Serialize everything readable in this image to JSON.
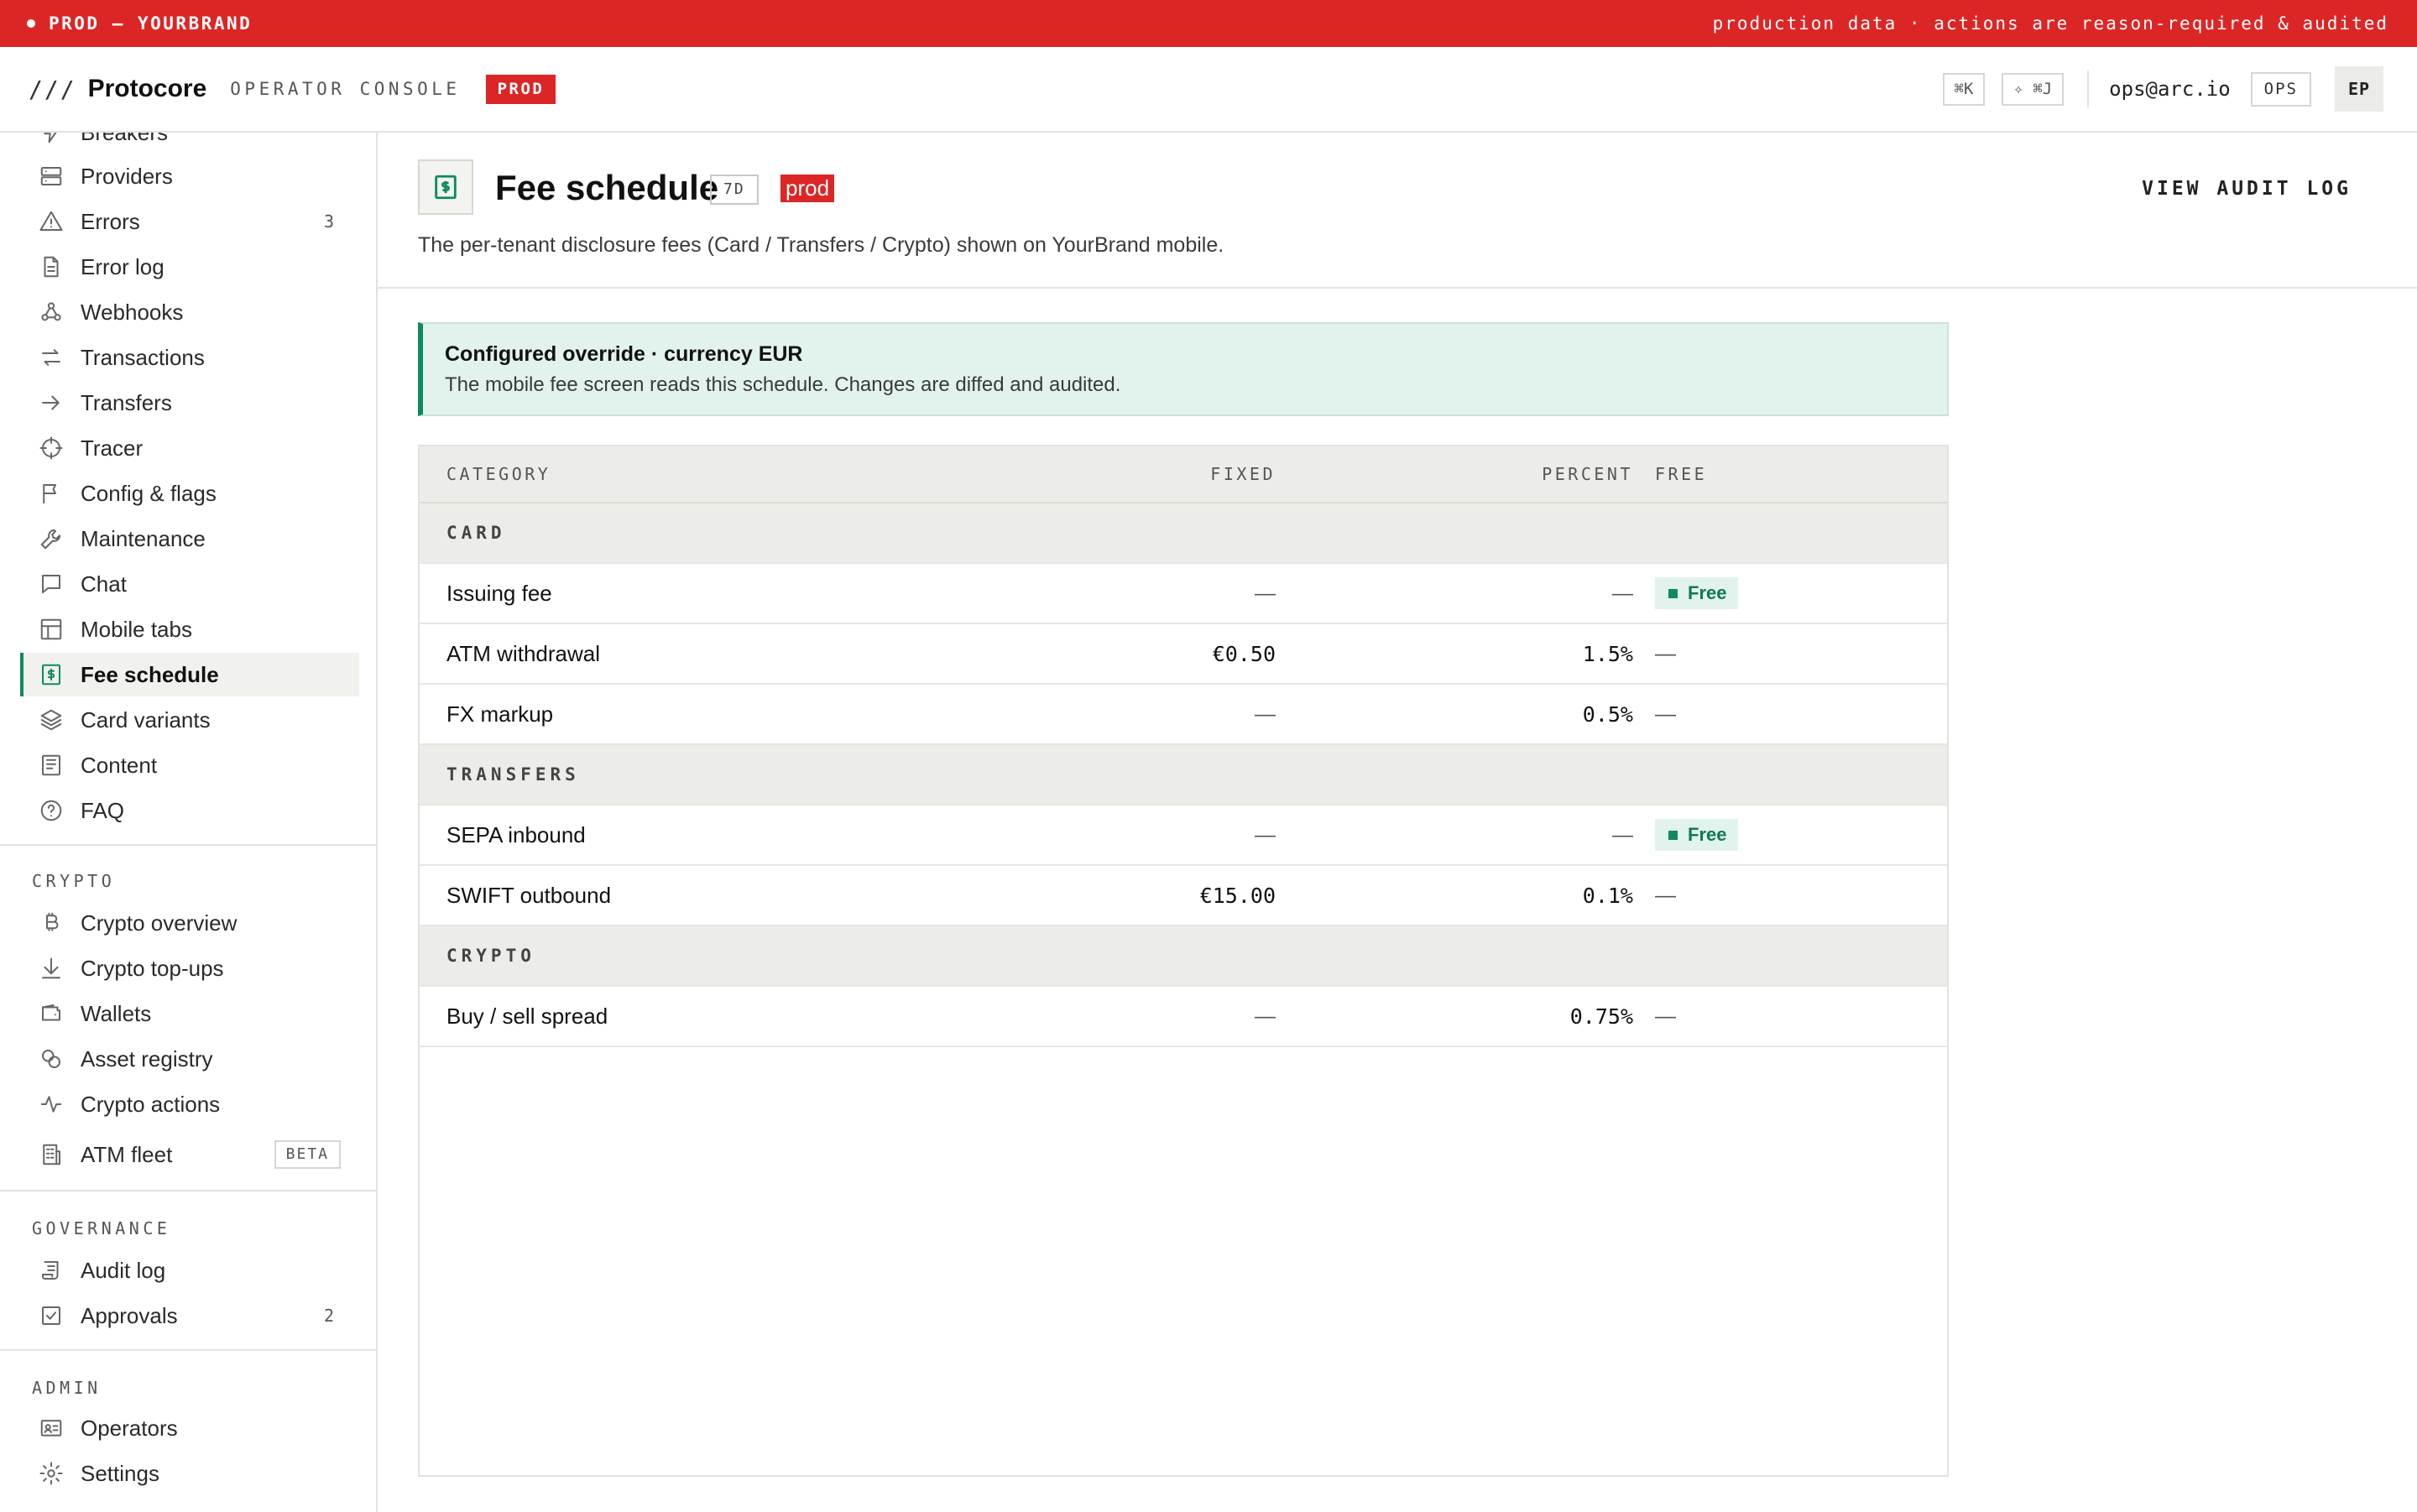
{
  "banner": {
    "env_label": "PROD — YOURBRAND",
    "notice": "production data · actions are reason-required & audited"
  },
  "header": {
    "brand_mark": "///",
    "brand_name": "Protocore",
    "console_label": "OPERATOR CONSOLE",
    "env_chip": "PROD",
    "shortcut_search": "⌘K",
    "shortcut_ai": "✧ ⌘J",
    "user_email": "ops@arc.io",
    "role": "OPS",
    "avatar_initials": "EP"
  },
  "sidebar": {
    "partial_item": "Breakers",
    "items": [
      {
        "label": "Providers",
        "icon": "server-icon"
      },
      {
        "label": "Errors",
        "icon": "warning-icon",
        "count": "3"
      },
      {
        "label": "Error log",
        "icon": "document-icon"
      },
      {
        "label": "Webhooks",
        "icon": "webhook-icon"
      },
      {
        "label": "Transactions",
        "icon": "swap-icon"
      },
      {
        "label": "Transfers",
        "icon": "arrow-right-icon"
      },
      {
        "label": "Tracer",
        "icon": "crosshair-icon"
      },
      {
        "label": "Config & flags",
        "icon": "flag-icon"
      },
      {
        "label": "Maintenance",
        "icon": "wrench-icon"
      },
      {
        "label": "Chat",
        "icon": "chat-icon"
      },
      {
        "label": "Mobile tabs",
        "icon": "layout-icon"
      },
      {
        "label": "Fee schedule",
        "icon": "dollar-receipt-icon",
        "active": true
      },
      {
        "label": "Card variants",
        "icon": "layers-icon"
      },
      {
        "label": "Content",
        "icon": "newspaper-icon"
      },
      {
        "label": "FAQ",
        "icon": "help-circle-icon"
      }
    ],
    "crypto_title": "CRYPTO",
    "crypto_items": [
      {
        "label": "Crypto overview",
        "icon": "bitcoin-icon"
      },
      {
        "label": "Crypto top-ups",
        "icon": "download-icon"
      },
      {
        "label": "Wallets",
        "icon": "wallet-icon"
      },
      {
        "label": "Asset registry",
        "icon": "coins-icon"
      },
      {
        "label": "Crypto actions",
        "icon": "activity-icon"
      },
      {
        "label": "ATM fleet",
        "icon": "building-icon",
        "badge": "BETA"
      }
    ],
    "governance_title": "GOVERNANCE",
    "governance_items": [
      {
        "label": "Audit log",
        "icon": "scroll-icon"
      },
      {
        "label": "Approvals",
        "icon": "check-square-icon",
        "count": "2"
      }
    ],
    "admin_title": "ADMIN",
    "admin_items": [
      {
        "label": "Operators",
        "icon": "id-card-icon"
      },
      {
        "label": "Settings",
        "icon": "gear-icon"
      }
    ]
  },
  "page": {
    "title": "Fee schedule",
    "range": "7D",
    "env_tag": "prod",
    "subtitle": "The per-tenant disclosure fees (Card / Transfers / Crypto) shown on YourBrand mobile.",
    "audit_link": "VIEW AUDIT LOG"
  },
  "notice": {
    "title": "Configured override · currency EUR",
    "body": "The mobile fee screen reads this schedule. Changes are diffed and audited."
  },
  "fees": {
    "columns": {
      "category": "CATEGORY",
      "fixed": "FIXED",
      "percent": "PERCENT",
      "free": "FREE"
    },
    "groups": [
      {
        "name": "CARD",
        "rows": [
          {
            "category": "Issuing fee",
            "fixed": "—",
            "percent": "—",
            "free": "Free"
          },
          {
            "category": "ATM withdrawal",
            "fixed": "€0.50",
            "percent": "1.5%",
            "free": "—"
          },
          {
            "category": "FX markup",
            "fixed": "—",
            "percent": "0.5%",
            "free": "—"
          }
        ]
      },
      {
        "name": "TRANSFERS",
        "rows": [
          {
            "category": "SEPA inbound",
            "fixed": "—",
            "percent": "—",
            "free": "Free"
          },
          {
            "category": "SWIFT outbound",
            "fixed": "€15.00",
            "percent": "0.1%",
            "free": "—"
          }
        ]
      },
      {
        "name": "CRYPTO",
        "rows": [
          {
            "category": "Buy / sell spread",
            "fixed": "—",
            "percent": "0.75%",
            "free": "—"
          }
        ]
      }
    ]
  },
  "colors": {
    "prod_red": "#dc2626",
    "accent_green": "#0f8a5f",
    "notice_bg": "#e2f2ec"
  }
}
